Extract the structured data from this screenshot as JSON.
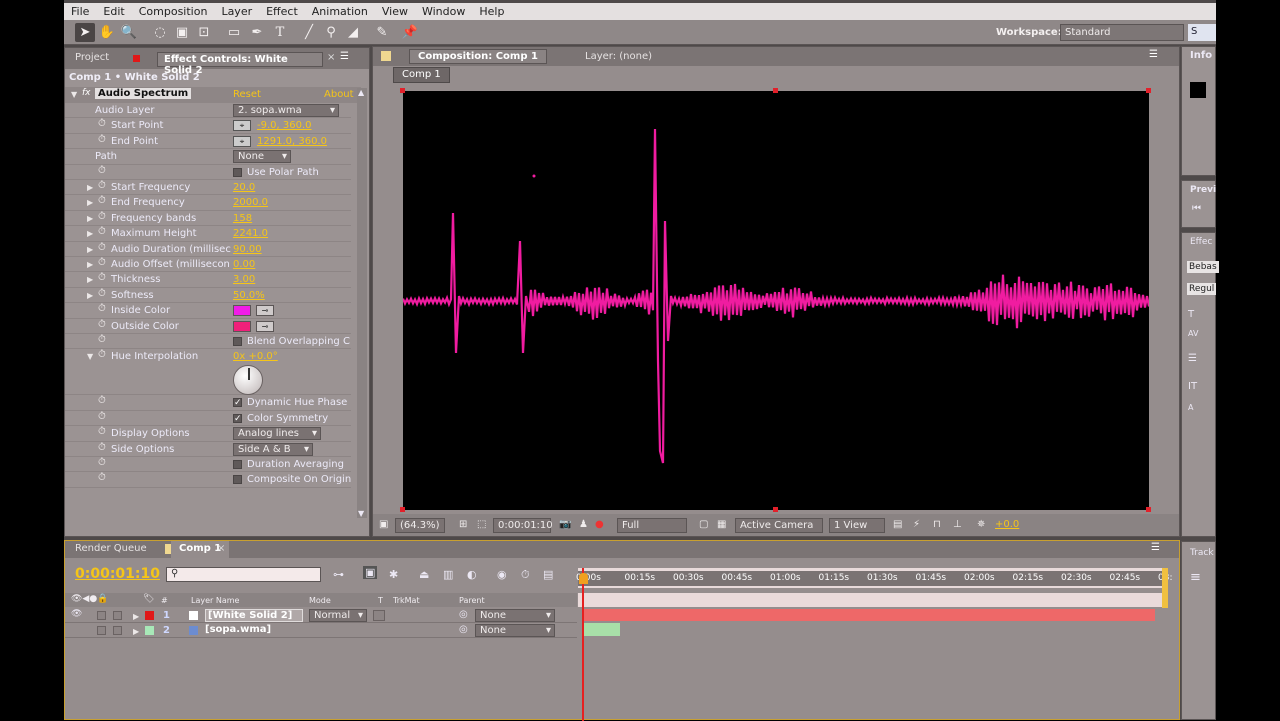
{
  "menu": [
    "File",
    "Edit",
    "Composition",
    "Layer",
    "Effect",
    "Animation",
    "View",
    "Window",
    "Help"
  ],
  "workspace": {
    "label": "Workspace:",
    "value": "Standard",
    "search": "S"
  },
  "left_panel": {
    "tabs": {
      "project": "Project",
      "effect_controls": "Effect Controls: White Solid 2"
    },
    "breadcrumb": "Comp 1 • White Solid 2",
    "effect": {
      "name": "Audio Spectrum",
      "reset": "Reset",
      "about": "About"
    },
    "props": [
      {
        "label": "Audio Layer",
        "dropdown": "2. sopa.wma"
      },
      {
        "label": "Start Point",
        "value": "-9.0, 360.0"
      },
      {
        "label": "End Point",
        "value": "1291.0, 360.0"
      },
      {
        "label": "Path",
        "dropdown": "None"
      },
      {
        "label": "",
        "checkbox": "Use Polar Path",
        "checked": false
      },
      {
        "label": "Start Frequency",
        "value": "20.0"
      },
      {
        "label": "End Frequency",
        "value": "2000.0"
      },
      {
        "label": "Frequency bands",
        "value": "158"
      },
      {
        "label": "Maximum Height",
        "value": "2241.0"
      },
      {
        "label": "Audio Duration (millisec",
        "value": "90.00"
      },
      {
        "label": "Audio Offset (millisecon",
        "value": "0.00"
      },
      {
        "label": "Thickness",
        "value": "3.00"
      },
      {
        "label": "Softness",
        "value": "50.0%"
      },
      {
        "label": "Inside Color",
        "color": "#f01ce8"
      },
      {
        "label": "Outside Color",
        "color": "#f0207a"
      },
      {
        "label": "",
        "checkbox": "Blend Overlapping C",
        "checked": false
      },
      {
        "label": "Hue Interpolation",
        "value": "0x +0.0°"
      },
      {
        "label": "",
        "checkbox": "Dynamic Hue Phase",
        "checked": true
      },
      {
        "label": "",
        "checkbox": "Color Symmetry",
        "checked": true
      },
      {
        "label": "Display Options",
        "dropdown": "Analog lines"
      },
      {
        "label": "Side Options",
        "dropdown": "Side A & B"
      },
      {
        "label": "",
        "checkbox": "Duration Averaging",
        "checked": false
      },
      {
        "label": "",
        "checkbox": "Composite On Origin",
        "checked": false
      }
    ]
  },
  "viewer": {
    "tab": "Composition: Comp 1",
    "layer_tab": "Layer: (none)",
    "comp_button": "Comp 1",
    "zoom": "(64.3%)",
    "timecode": "0:00:01:10",
    "resolution": "Full",
    "camera": "Active Camera",
    "views": "1 View",
    "exposure": "+0.0",
    "waveform_color": "#f01ca0"
  },
  "right_panels": {
    "info": "Info",
    "preview": "Previ",
    "effects": "Effec",
    "font": "Bebas",
    "style": "Regul",
    "tracker": "Track"
  },
  "timeline": {
    "tabs": {
      "render_queue": "Render Queue",
      "comp": "Comp 1"
    },
    "timecode": "0:00:01:10",
    "columns": {
      "layer_name": "Layer Name",
      "mode": "Mode",
      "t": "T",
      "trkmat": "TrkMat",
      "parent": "Parent",
      "num": "#"
    },
    "layers": [
      {
        "num": "1",
        "name": "[White Solid 2]",
        "mode": "Normal",
        "parent": "None",
        "label_color": "#e01818"
      },
      {
        "num": "2",
        "name": "[sopa.wma]",
        "mode": "",
        "parent": "None",
        "label_color": "#a8e8b8"
      }
    ],
    "ruler": [
      "0:00s",
      "00:15s",
      "00:30s",
      "00:45s",
      "01:00s",
      "01:15s",
      "01:30s",
      "01:45s",
      "02:00s",
      "02:15s",
      "02:30s",
      "02:45s",
      "03:"
    ]
  }
}
